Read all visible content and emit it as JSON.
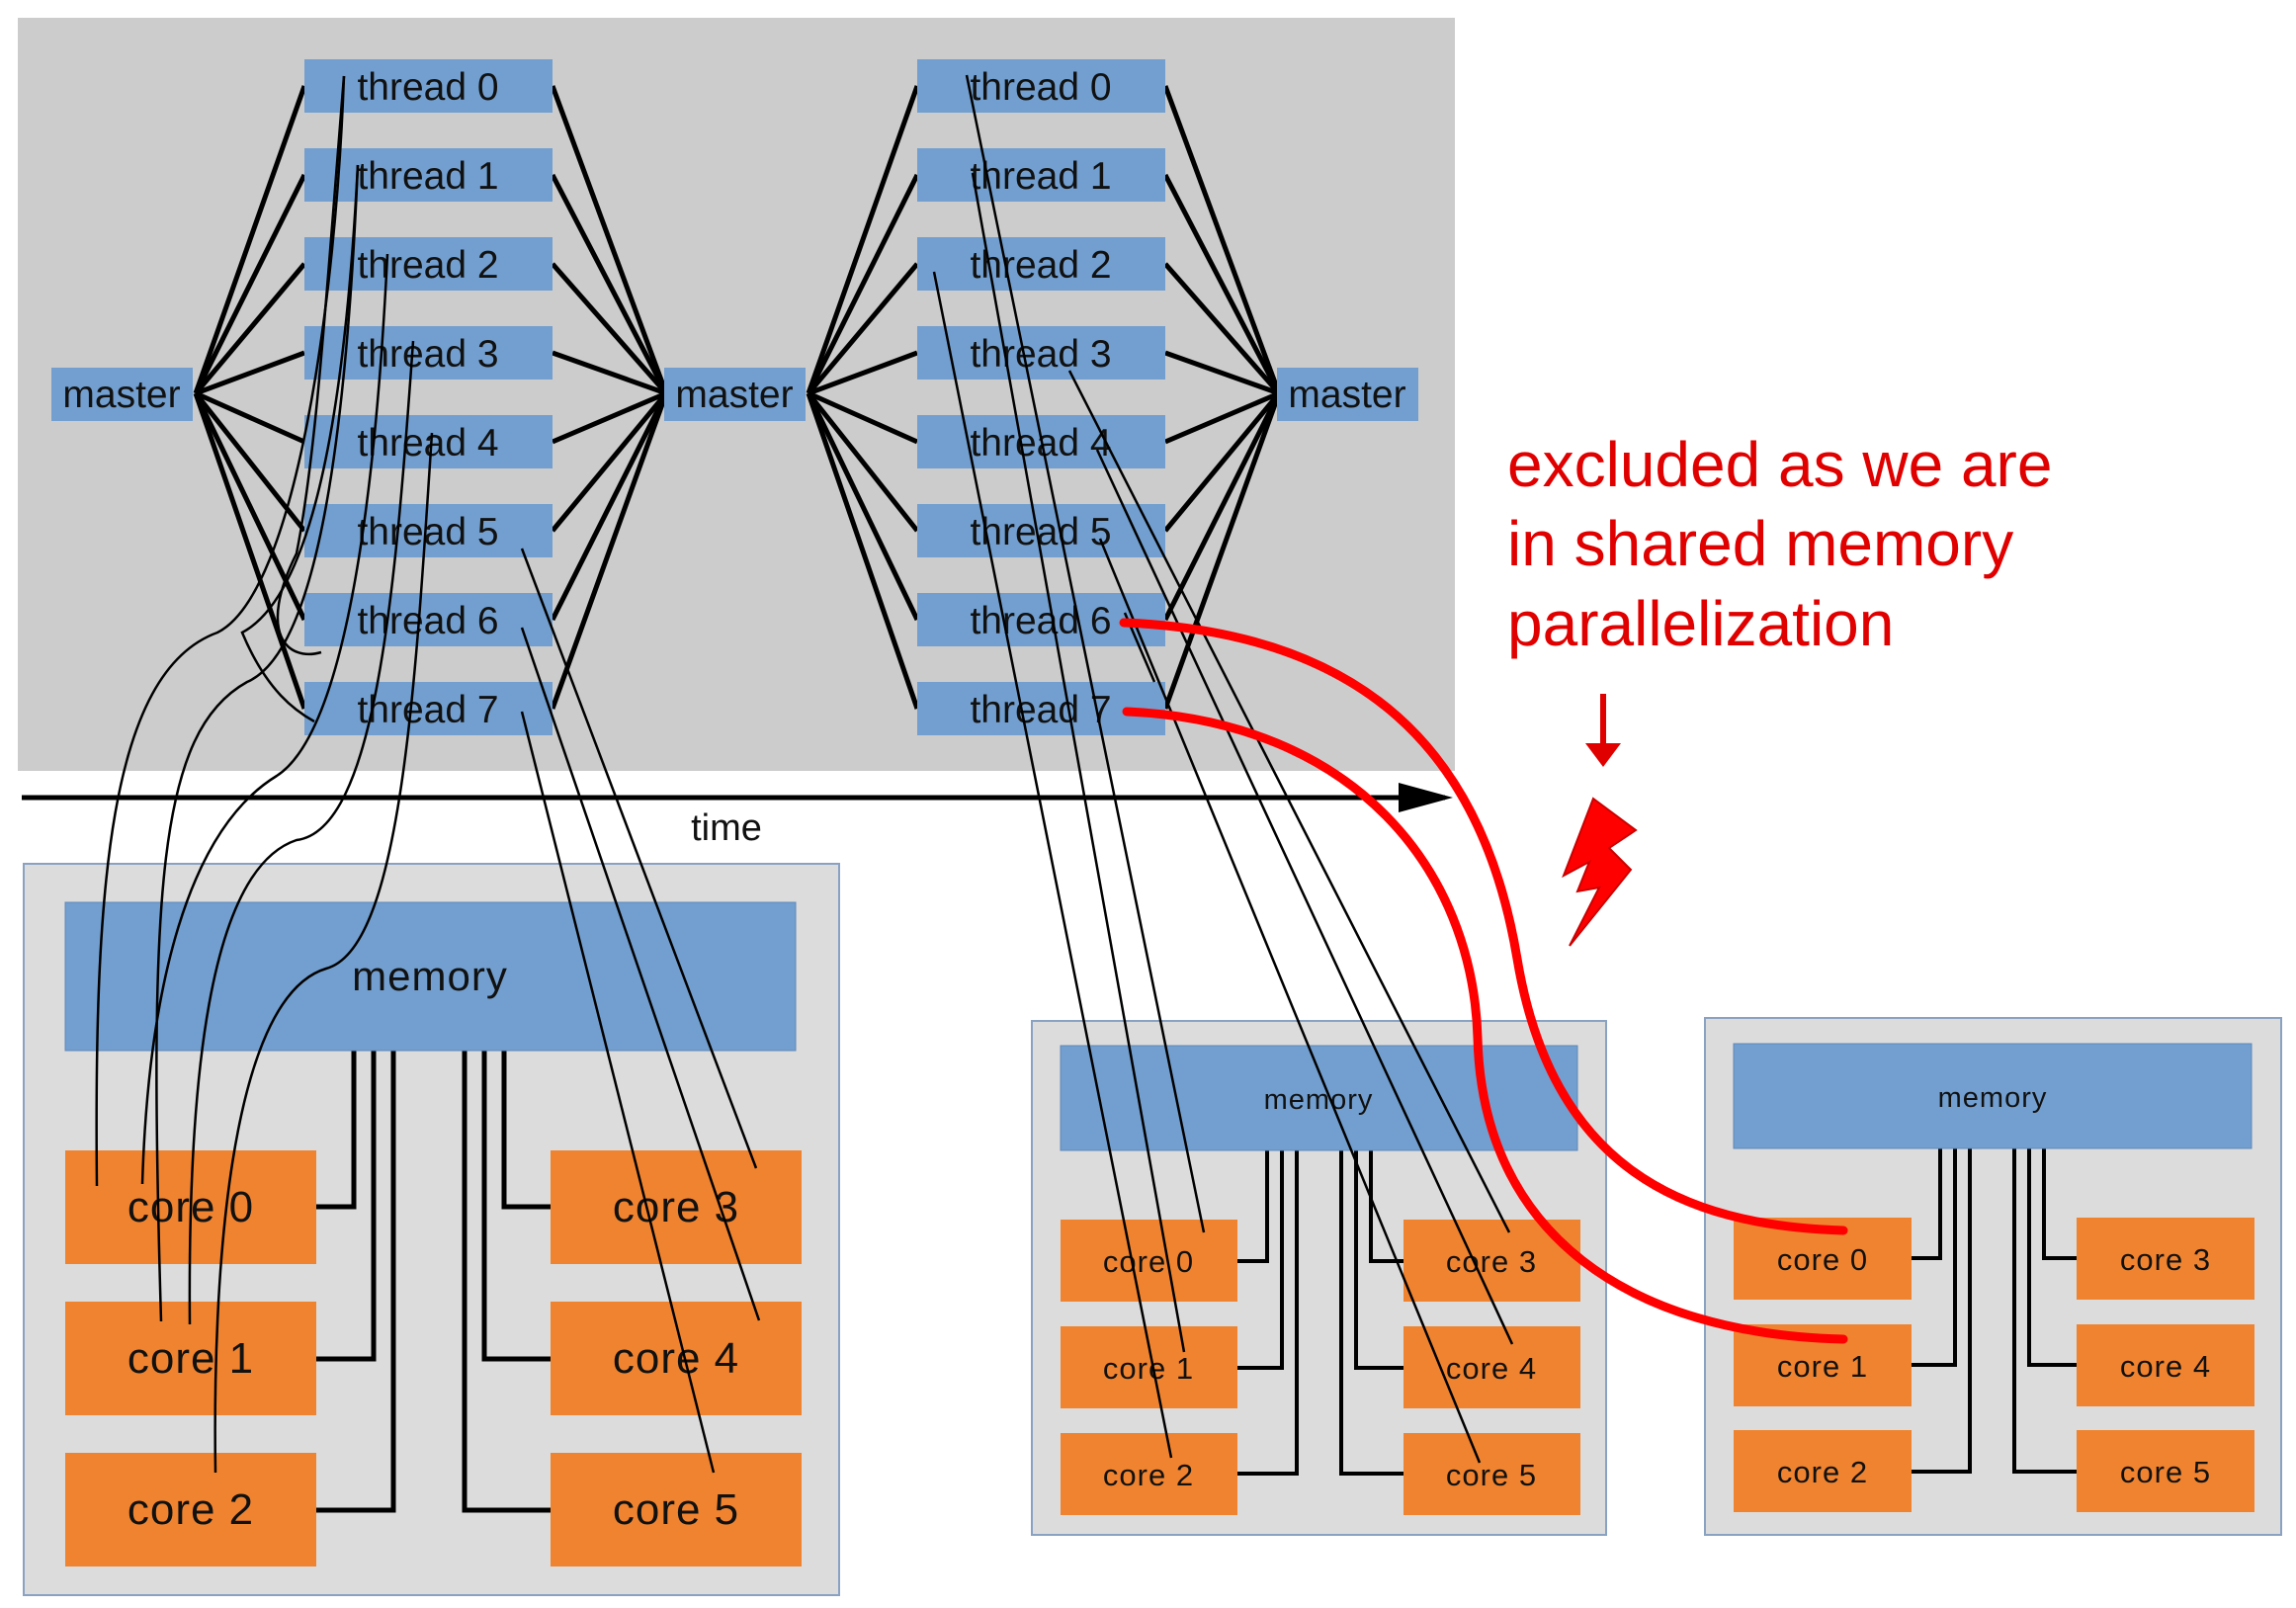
{
  "fork_join": {
    "master_label": "master",
    "threads": [
      "thread 0",
      "thread 1",
      "thread 2",
      "thread 3",
      "thread 4",
      "thread 5",
      "thread 6",
      "thread 7"
    ]
  },
  "timeline": {
    "label": "time"
  },
  "nodes": [
    {
      "memory_label": "memory",
      "cores": [
        "core 0",
        "core 1",
        "core 2",
        "core 3",
        "core 4",
        "core 5"
      ]
    },
    {
      "memory_label": "memory",
      "cores": [
        "core 0",
        "core 1",
        "core 2",
        "core 3",
        "core 4",
        "core 5"
      ]
    },
    {
      "memory_label": "memory",
      "cores": [
        "core 0",
        "core 1",
        "core 2",
        "core 3",
        "core 4",
        "core 5"
      ]
    }
  ],
  "annotation": {
    "lines": [
      "excluded as we are",
      "in shared memory",
      "parallelization"
    ],
    "color": "#e00000"
  },
  "colors": {
    "panel_gray": "#cccccc",
    "node_gray": "#dcdcdc",
    "blue_box": "#729fcf",
    "orange_core": "#f0832f",
    "red": "#ff0000"
  }
}
